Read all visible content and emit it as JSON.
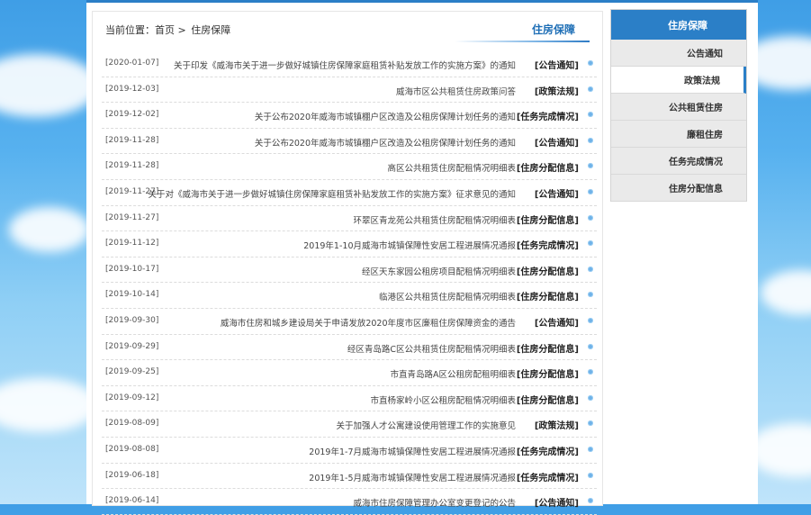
{
  "breadcrumb": {
    "label": "当前位置：",
    "home": "首页",
    "sep": ">",
    "current": "住房保障"
  },
  "section_title": "住房保障",
  "sidebar": {
    "heading": "住房保障",
    "items": [
      {
        "label": "公告通知",
        "active": false
      },
      {
        "label": "政策法规",
        "active": true
      },
      {
        "label": "公共租赁住房",
        "active": false
      },
      {
        "label": "廉租住房",
        "active": false
      },
      {
        "label": "任务完成情况",
        "active": false
      },
      {
        "label": "住房分配信息",
        "active": false
      }
    ]
  },
  "articles": [
    {
      "category": "[公告通知]",
      "title": "关于印发《威海市关于进一步做好城镇住房保障家庭租赁补贴发放工作的实施方案》的通知",
      "date": "[2020-01-07]"
    },
    {
      "category": "[政策法规]",
      "title": "威海市区公共租赁住房政策问答",
      "date": "[2019-12-03]"
    },
    {
      "category": "[任务完成情况]",
      "title": "关于公布2020年威海市城镇棚户区改造及公租房保障计划任务的通知",
      "date": "[2019-12-02]"
    },
    {
      "category": "[公告通知]",
      "title": "关于公布2020年威海市城镇棚户区改造及公租房保障计划任务的通知",
      "date": "[2019-11-28]"
    },
    {
      "category": "[住房分配信息]",
      "title": "高区公共租赁住房配租情况明细表",
      "date": "[2019-11-28]"
    },
    {
      "category": "[公告通知]",
      "title": "关于对《威海市关于进一步做好城镇住房保障家庭租赁补贴发放工作的实施方案》征求意见的通知",
      "date": "[2019-11-27]"
    },
    {
      "category": "[住房分配信息]",
      "title": "环翠区青龙苑公共租赁住房配租情况明细表",
      "date": "[2019-11-27]"
    },
    {
      "category": "[任务完成情况]",
      "title": "2019年1-10月威海市城镇保障性安居工程进展情况通报",
      "date": "[2019-11-12]"
    },
    {
      "category": "[住房分配信息]",
      "title": "经区天东家园公租房项目配租情况明细表",
      "date": "[2019-10-17]"
    },
    {
      "category": "[住房分配信息]",
      "title": "临港区公共租赁住房配租情况明细表",
      "date": "[2019-10-14]"
    },
    {
      "category": "[公告通知]",
      "title": "威海市住房和城乡建设局关于申请发放2020年度市区廉租住房保障资金的通告",
      "date": "[2019-09-30]"
    },
    {
      "category": "[住房分配信息]",
      "title": "经区青岛路C区公共租赁住房配租情况明细表",
      "date": "[2019-09-29]"
    },
    {
      "category": "[住房分配信息]",
      "title": "市直青岛路A区公租房配租明细表",
      "date": "[2019-09-25]"
    },
    {
      "category": "[住房分配信息]",
      "title": "市直杨家岭小区公租房配租情况明细表",
      "date": "[2019-09-12]"
    },
    {
      "category": "[政策法规]",
      "title": "关于加强人才公寓建设使用管理工作的实施意见",
      "date": "[2019-08-09]"
    },
    {
      "category": "[任务完成情况]",
      "title": "2019年1-7月威海市城镇保障性安居工程进展情况通报",
      "date": "[2019-08-08]"
    },
    {
      "category": "[任务完成情况]",
      "title": "2019年1-5月威海市城镇保障性安居工程进展情况通报",
      "date": "[2019-06-18]"
    },
    {
      "category": "[公告通知]",
      "title": "威海市住房保障管理办公室变更登记的公告",
      "date": "[2019-06-14]"
    }
  ],
  "colors": {
    "accent": "#2b7fc7",
    "sky": "#57b1ef"
  }
}
